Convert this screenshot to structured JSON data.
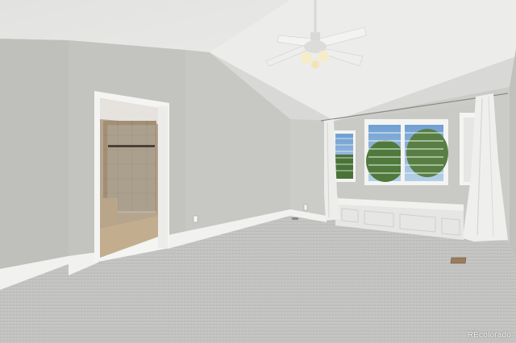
{
  "photo": {
    "subject": "",
    "watermark": "REcolorado"
  },
  "colors": {
    "ceiling": "#e9e9e7",
    "wall_left": "#bdbdb8",
    "wall_mid": "#c6c6c2",
    "wall_right": "#c9c9c5",
    "baseboard": "#f2f2f0",
    "carpet": "#c2c2c0",
    "door_frame": "#f4f4f2",
    "bathroom_tile": "#9c8a72",
    "window_glass": "#8fb6d8",
    "trees": "#4f7a3c",
    "curtain": "#ededeb",
    "window_seat": "#e7e7e5"
  }
}
